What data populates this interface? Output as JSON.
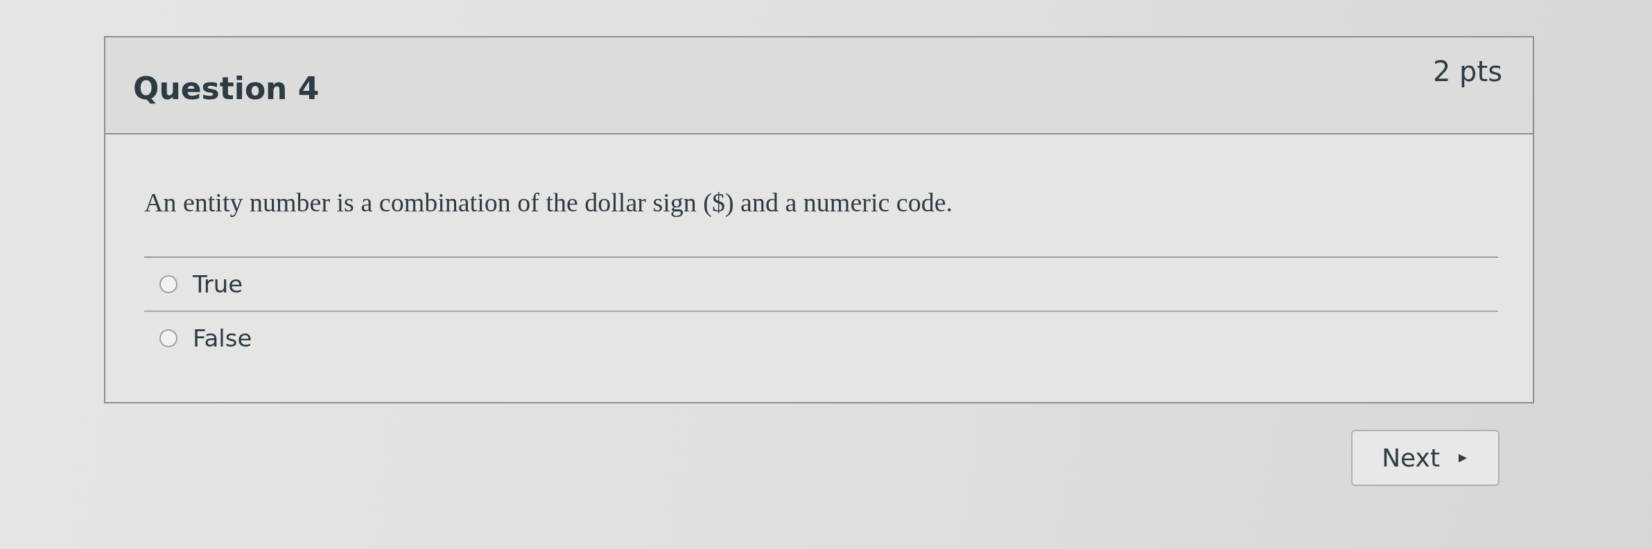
{
  "question": {
    "title": "Question 4",
    "points": "2 pts",
    "text": "An entity number is a combination of the dollar sign ($) and a numeric code.",
    "options": [
      {
        "label": "True",
        "selected": false
      },
      {
        "label": "False",
        "selected": false
      }
    ]
  },
  "next_button": {
    "label": "Next"
  }
}
